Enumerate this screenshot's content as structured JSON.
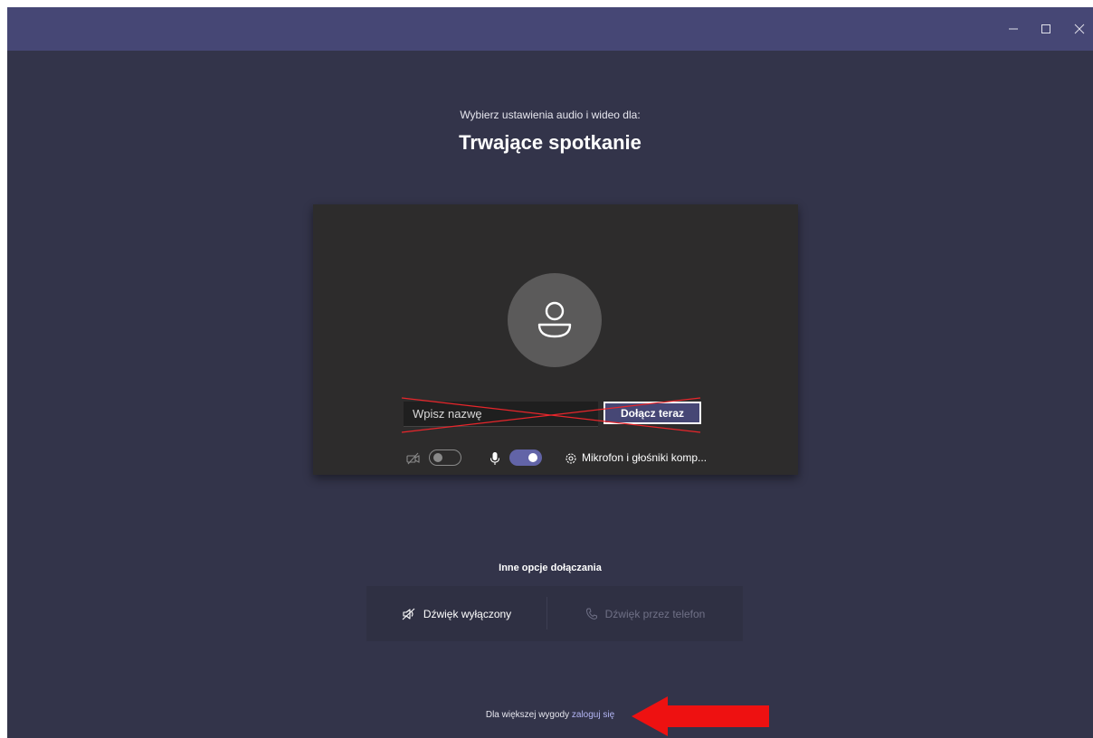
{
  "window": {
    "controls": [
      "minimize-icon",
      "maximize-icon",
      "close-icon"
    ]
  },
  "header": {
    "subtitle": "Wybierz ustawienia audio i wideo dla:",
    "title": "Trwające spotkanie"
  },
  "preview": {
    "avatar_icon": "person-icon",
    "name_placeholder": "Wpisz nazwę",
    "join_label": "Dołącz teraz",
    "camera_enabled": false,
    "mic_enabled": true,
    "device_label": "Mikrofon i głośniki komp..."
  },
  "other_options": {
    "label": "Inne opcje dołączania",
    "audio_off_label": "Dźwięk wyłączony",
    "phone_audio_label": "Dźwięk przez telefon"
  },
  "footer": {
    "text": "Dla większej wygody ",
    "link": "zaloguj się"
  },
  "annotations": {
    "cross_color": "#e8262b",
    "arrow_color": "#ee1111"
  },
  "colors": {
    "background": "#33344a",
    "titlebar": "#464775",
    "accent": "#6264a7",
    "link": "#b3b5f4"
  }
}
